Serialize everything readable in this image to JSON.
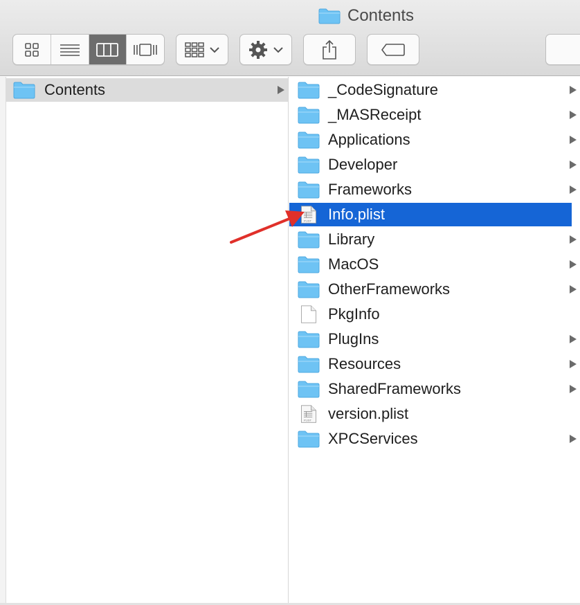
{
  "window": {
    "title": "Contents"
  },
  "toolbar": {
    "view_modes": [
      {
        "name": "icon-view",
        "icon": "grid-icon",
        "active": false
      },
      {
        "name": "list-view",
        "icon": "list-icon",
        "active": false
      },
      {
        "name": "column-view",
        "icon": "columns-icon",
        "active": true
      },
      {
        "name": "cover-flow-view",
        "icon": "cover-flow-icon",
        "active": false
      }
    ],
    "arrange_icon": "arrange-grid-icon",
    "action_icon": "gear-icon",
    "share_icon": "share-icon",
    "tags_icon": "tag-icon"
  },
  "column1": {
    "items": [
      {
        "label": "Contents",
        "type": "folder",
        "selected": true,
        "has_children": true
      }
    ]
  },
  "column2": {
    "items": [
      {
        "label": "_CodeSignature",
        "type": "folder",
        "has_children": true
      },
      {
        "label": "_MASReceipt",
        "type": "folder",
        "has_children": true
      },
      {
        "label": "Applications",
        "type": "folder",
        "has_children": true
      },
      {
        "label": "Developer",
        "type": "folder",
        "has_children": true
      },
      {
        "label": "Frameworks",
        "type": "folder",
        "has_children": true
      },
      {
        "label": "Info.plist",
        "type": "plist",
        "has_children": false,
        "selected": true
      },
      {
        "label": "Library",
        "type": "folder",
        "has_children": true
      },
      {
        "label": "MacOS",
        "type": "folder",
        "has_children": true
      },
      {
        "label": "OtherFrameworks",
        "type": "folder",
        "has_children": true
      },
      {
        "label": "PkgInfo",
        "type": "file",
        "has_children": false
      },
      {
        "label": "PlugIns",
        "type": "folder",
        "has_children": true
      },
      {
        "label": "Resources",
        "type": "folder",
        "has_children": true
      },
      {
        "label": "SharedFrameworks",
        "type": "folder",
        "has_children": true
      },
      {
        "label": "version.plist",
        "type": "plist",
        "has_children": false
      },
      {
        "label": "XPCServices",
        "type": "folder",
        "has_children": true
      }
    ]
  },
  "colors": {
    "selection": "#1565d6",
    "folder": "#6ec3f4",
    "annotation_arrow": "#e0302a"
  }
}
